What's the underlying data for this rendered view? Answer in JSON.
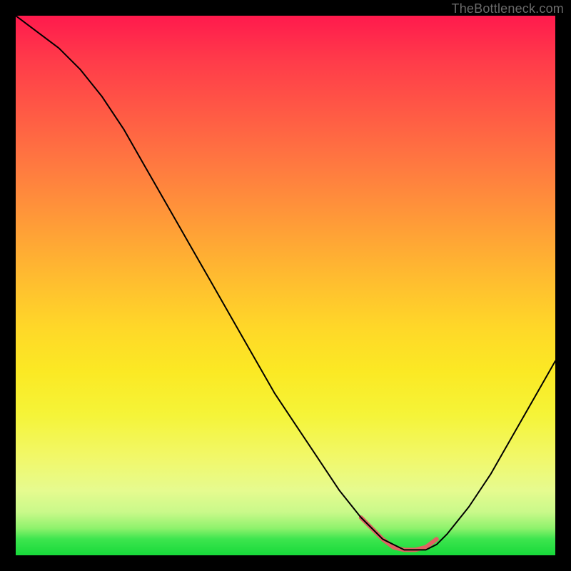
{
  "watermark": "TheBottleneck.com",
  "chart_data": {
    "type": "line",
    "title": "",
    "xlabel": "",
    "ylabel": "",
    "xlim": [
      0,
      100
    ],
    "ylim": [
      0,
      100
    ],
    "grid": false,
    "series": [
      {
        "name": "main-curve",
        "color": "#000000",
        "stroke_width": 2,
        "x": [
          0,
          4,
          8,
          12,
          16,
          20,
          24,
          28,
          32,
          36,
          40,
          44,
          48,
          52,
          56,
          60,
          64,
          66,
          68,
          70,
          72,
          74,
          76,
          78,
          80,
          84,
          88,
          92,
          96,
          100
        ],
        "values": [
          100,
          97,
          94,
          90,
          85,
          79,
          72,
          65,
          58,
          51,
          44,
          37,
          30,
          24,
          18,
          12,
          7,
          5,
          3,
          2,
          1,
          1,
          1,
          2,
          4,
          9,
          15,
          22,
          29,
          36
        ]
      },
      {
        "name": "highlight-segment",
        "color": "#e06262",
        "stroke_width": 6,
        "x": [
          64,
          66,
          68,
          70,
          72,
          74,
          76,
          78
        ],
        "values": [
          7,
          5,
          3,
          1.5,
          1,
          1,
          1.5,
          3
        ]
      }
    ],
    "background_gradient": {
      "stops": [
        {
          "pos": 0,
          "c": "#ff1a4d"
        },
        {
          "pos": 18,
          "c": "#ff5a45"
        },
        {
          "pos": 38,
          "c": "#ff9a38"
        },
        {
          "pos": 58,
          "c": "#ffd828"
        },
        {
          "pos": 74,
          "c": "#f5f438"
        },
        {
          "pos": 92,
          "c": "#c9f98a"
        },
        {
          "pos": 100,
          "c": "#17d93a"
        }
      ]
    }
  }
}
